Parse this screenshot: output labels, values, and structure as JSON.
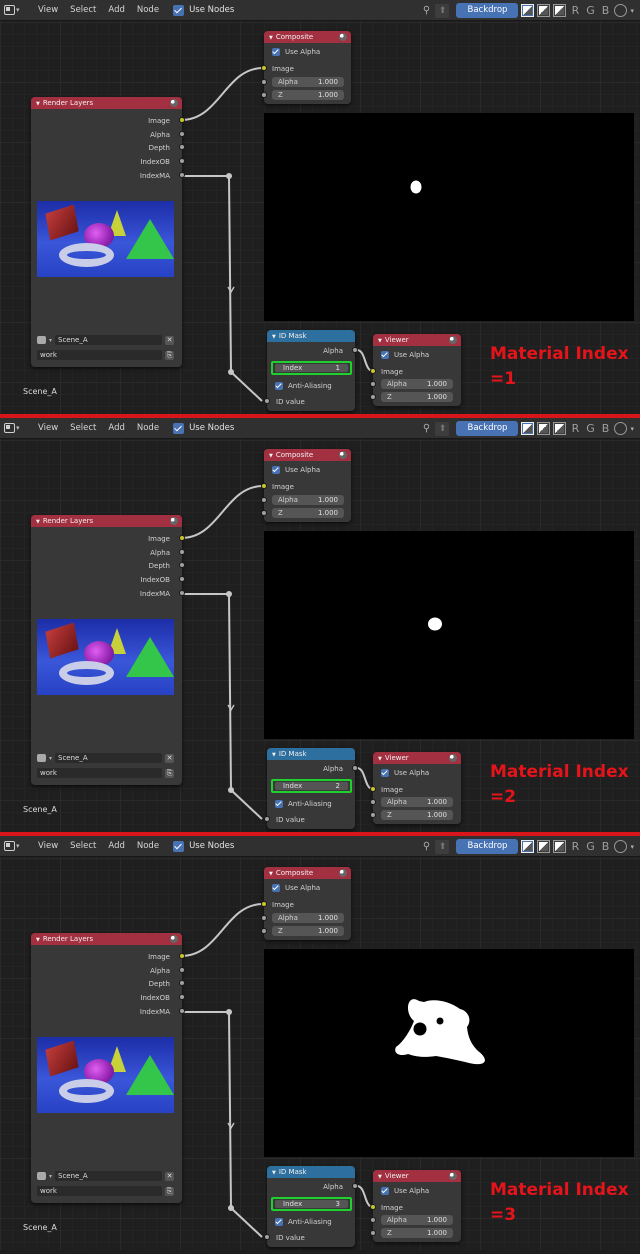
{
  "colors": {
    "separator": "#d8151b",
    "annotation": "#e5141b",
    "render_node_header": "#a33041",
    "idmask_node_header": "#2d6f9e",
    "index_highlight": "#1ed12d",
    "checkbox": "#4772b3"
  },
  "header": {
    "editor_icon": "node-editor-icon",
    "menu": [
      "View",
      "Select",
      "Add",
      "Node"
    ],
    "use_nodes": "Use Nodes",
    "backdrop": "Backdrop",
    "channels": [
      "R",
      "G",
      "B"
    ]
  },
  "composite": {
    "title": "Composite",
    "use_alpha": "Use Alpha",
    "image": "Image",
    "alpha_label": "Alpha",
    "alpha_value": "1.000",
    "z_label": "Z",
    "z_value": "1.000"
  },
  "render_layers": {
    "title": "Render Layers",
    "outputs": [
      "Image",
      "Alpha",
      "Depth",
      "IndexOB",
      "IndexMA"
    ],
    "scene": "Scene_A",
    "layer": "work"
  },
  "id_mask": {
    "title": "ID Mask",
    "alpha": "Alpha",
    "index_label": "Index",
    "anti_aliasing": "Anti-Aliasing",
    "id_value": "ID value"
  },
  "viewer": {
    "title": "Viewer",
    "use_alpha": "Use Alpha",
    "image": "Image",
    "alpha_label": "Alpha",
    "alpha_value": "1.000",
    "z_label": "Z",
    "z_value": "1.000"
  },
  "scene_label": "Scene_A",
  "panels": [
    {
      "index_value": "1",
      "annotation_line1": "Material Index",
      "annotation_line2": "=1",
      "mask_shape": "small-blob"
    },
    {
      "index_value": "2",
      "annotation_line1": "Material Index",
      "annotation_line2": "=2",
      "mask_shape": "small-blob"
    },
    {
      "index_value": "3",
      "annotation_line1": "Material Index",
      "annotation_line2": "=3",
      "mask_shape": "monkey-head"
    }
  ]
}
